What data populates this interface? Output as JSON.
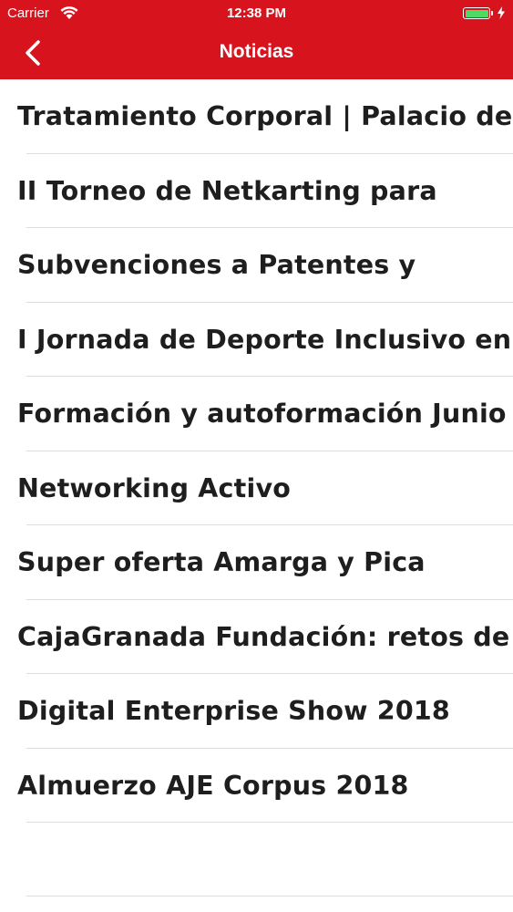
{
  "status_bar": {
    "carrier": "Carrier",
    "time": "12:38 PM",
    "icons": [
      "wifi-icon",
      "battery-icon",
      "charging-icon"
    ],
    "battery_color": "#4cd964"
  },
  "nav": {
    "title": "Noticias",
    "back_icon": "chevron-left-icon",
    "background_color": "#d7141e"
  },
  "news": [
    {
      "title": "Tratamiento Corporal | Palacio de"
    },
    {
      "title": "II Torneo de Netkarting para"
    },
    {
      "title": "Subvenciones a Patentes y"
    },
    {
      "title": "I Jornada de Deporte Inclusivo en"
    },
    {
      "title": "Formación y autoformación Junio"
    },
    {
      "title": "Networking Activo"
    },
    {
      "title": "Super oferta Amarga y Pica"
    },
    {
      "title": "CajaGranada Fundación: retos de"
    },
    {
      "title": "Digital Enterprise Show 2018"
    },
    {
      "title": "Almuerzo AJE Corpus 2018"
    },
    {
      "title": ""
    }
  ]
}
